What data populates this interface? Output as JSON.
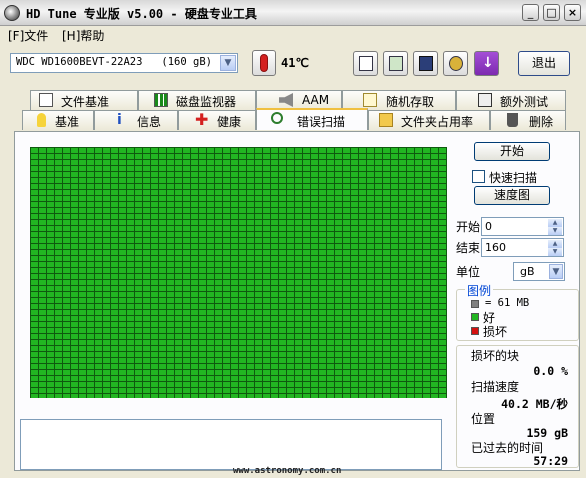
{
  "window": {
    "title": "HD Tune 专业版 v5.00 - 硬盘专业工具",
    "minimize": "_",
    "maximize": "□",
    "close": "×"
  },
  "menu": [
    {
      "label": "[F]文件"
    },
    {
      "label": "[H]帮助"
    }
  ],
  "toolbar": {
    "drive": "WDC WD1600BEVT-22A23   (160 gB)",
    "temperature": "41℃",
    "exit_label": "退出",
    "icons": [
      "copy-text-icon",
      "copy-screenshot-icon",
      "save-icon",
      "options-icon",
      "download-icon"
    ]
  },
  "tabs_top": [
    {
      "label": "文件基准",
      "icon": "file-benchmark-icon"
    },
    {
      "label": "磁盘监视器",
      "icon": "disk-monitor-icon"
    },
    {
      "label": "AAM",
      "icon": "speaker-icon"
    },
    {
      "label": "随机存取",
      "icon": "random-access-icon"
    },
    {
      "label": "额外测试",
      "icon": "extra-tests-icon"
    }
  ],
  "tabs_bottom": [
    {
      "label": "基准",
      "icon": "benchmark-icon"
    },
    {
      "label": "信息",
      "icon": "info-icon"
    },
    {
      "label": "健康",
      "icon": "health-icon"
    },
    {
      "label": "错误扫描",
      "icon": "search-icon",
      "active": true
    },
    {
      "label": "文件夹占用率",
      "icon": "folder-icon"
    },
    {
      "label": "删除",
      "icon": "trash-icon"
    }
  ],
  "scan": {
    "start_button": "开始",
    "quick_scan_label": "快速扫描",
    "quick_scan_checked": false,
    "speed_map_button": "速度图",
    "start_label": "开始",
    "start_value": "0",
    "end_label": "结束",
    "end_value": "160",
    "unit_label": "单位",
    "unit_value": "gB",
    "legend_title": "图例",
    "legend_block": "= 61 MB",
    "legend_good": "好",
    "legend_bad": "损坏",
    "bad_blocks_label": "损坏的块",
    "bad_blocks_value": "0.0 %",
    "scan_speed_label": "扫描速度",
    "scan_speed_value": "40.2 MB/秒",
    "position_label": "位置",
    "position_value": "159 gB",
    "elapsed_label": "已过去的时间",
    "elapsed_value": "57:29",
    "block_good_color": "#22b622",
    "block_bad_color": "#d41010"
  },
  "watermark": "www.astronomy.com.cn"
}
